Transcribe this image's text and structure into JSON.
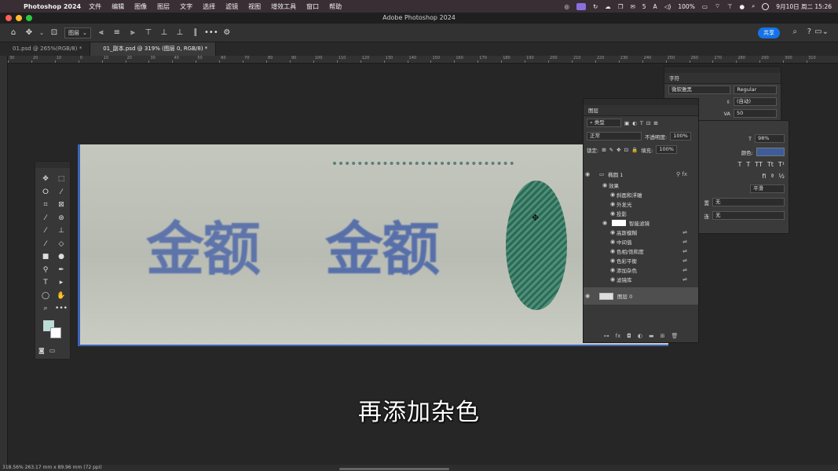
{
  "menubar": {
    "app_name": "Photoshop 2024",
    "items": [
      "文件",
      "编辑",
      "图像",
      "图层",
      "文字",
      "选择",
      "滤镜",
      "视图",
      "增效工具",
      "窗口",
      "帮助"
    ],
    "status": {
      "wechat_count": "5",
      "input": "A",
      "battery": "100%",
      "datetime": "9月10日 周二  15:26"
    }
  },
  "window": {
    "title": "Adobe Photoshop 2024"
  },
  "options": {
    "auto_select_value": "图层",
    "share_label": "共享"
  },
  "tabs": [
    {
      "label": "01.psd @ 265%(RGB/8) *",
      "active": false
    },
    {
      "label": "01_副本.psd @ 319% (图层 0, RGB/8) *",
      "active": true
    }
  ],
  "ruler": {
    "labels": [
      "30",
      "20",
      "10",
      "0",
      "10",
      "20",
      "30",
      "40",
      "50",
      "60",
      "70",
      "80",
      "90",
      "100",
      "110",
      "120",
      "130",
      "140",
      "150",
      "160",
      "170",
      "180",
      "190",
      "200",
      "210",
      "220",
      "230",
      "240",
      "250",
      "260",
      "270",
      "280",
      "290",
      "300",
      "310"
    ]
  },
  "document": {
    "text_a": "金额",
    "text_b": "金额"
  },
  "subtitle": "再添加杂色",
  "status_bar": "318.56%   263.17 mm x 89.96 mm (72 ppi)",
  "character_panel": {
    "title": "字符",
    "font_family": "微软雅黑",
    "font_style": "Regular",
    "leading": "(自动)",
    "tracking": "50",
    "vertical_scale": "98%",
    "color_label": "颜色:",
    "antialias": "平滑"
  },
  "paragraph_panel": {
    "label_a": "置",
    "value_a": "无",
    "label_b": "连",
    "value_b": "无"
  },
  "layers_panel": {
    "title": "图层",
    "filter_label": "类型",
    "blend_mode": "正常",
    "opacity_label": "不透明度:",
    "opacity_value": "100%",
    "lock_label": "锁定:",
    "fill_label": "填充:",
    "fill_value": "100%",
    "layers": [
      {
        "name": "椭圆 1",
        "kind": "layer"
      },
      {
        "name": "效果",
        "kind": "effects"
      },
      {
        "name": "斜面和浮雕",
        "kind": "effect"
      },
      {
        "name": "外发光",
        "kind": "effect"
      },
      {
        "name": "投影",
        "kind": "effect"
      },
      {
        "name": "智能滤镜",
        "kind": "smartfilter"
      },
      {
        "name": "高斯模糊",
        "kind": "filter"
      },
      {
        "name": "中间值",
        "kind": "filter"
      },
      {
        "name": "色相/饱和度",
        "kind": "filter"
      },
      {
        "name": "色彩平衡",
        "kind": "filter"
      },
      {
        "name": "添加杂色",
        "kind": "filter"
      },
      {
        "name": "滤镜库",
        "kind": "filter"
      },
      {
        "name": "图层 0",
        "kind": "layer"
      }
    ]
  },
  "colors": {
    "accent": "#1473e6",
    "doc_border": "#3b64b8",
    "foreground": "#b9ded7",
    "oval": "#2d6a56"
  }
}
